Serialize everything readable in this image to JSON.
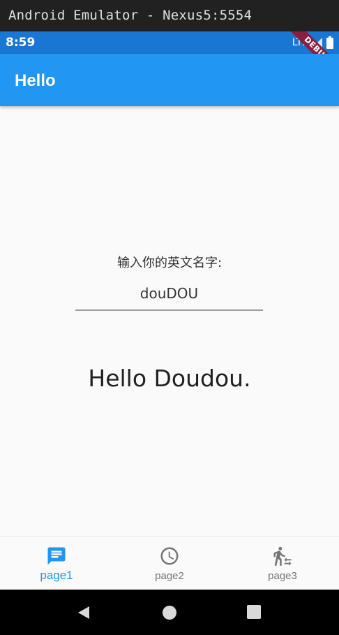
{
  "window": {
    "title": "Android Emulator - Nexus5:5554"
  },
  "status_bar": {
    "time": "8:59",
    "network": "LTE",
    "debug_banner": "DEBUG"
  },
  "app_bar": {
    "title": "Hello"
  },
  "main": {
    "prompt_label": "输入你的英文名字:",
    "name_input_value": "douDOU",
    "greeting": "Hello Doudou."
  },
  "bottom_nav": {
    "items": [
      {
        "label": "page1",
        "icon": "chat-bubble-icon",
        "active": true
      },
      {
        "label": "page2",
        "icon": "clock-icon",
        "active": false
      },
      {
        "label": "page3",
        "icon": "transfer-within-station-icon",
        "active": false
      }
    ]
  },
  "colors": {
    "primary": "#2196f3",
    "primary_dark": "#1976d2",
    "inactive": "#757575",
    "background": "#fafafa"
  }
}
